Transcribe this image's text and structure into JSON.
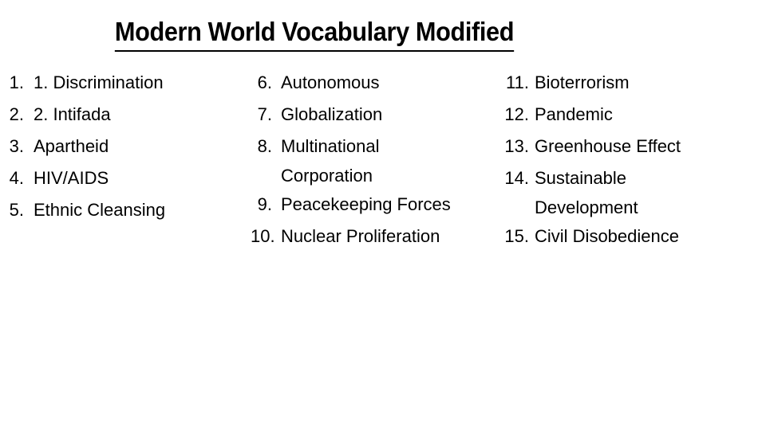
{
  "slide": {
    "title": "Modern World Vocabulary Modified",
    "background_color": "#ffffff",
    "text_color": "#000000"
  },
  "columns": [
    {
      "name": "column-one",
      "items": [
        {
          "number": "1.",
          "text": "1.  Discrimination",
          "lines": [
            "1.  Discrimination"
          ]
        },
        {
          "number": "2.",
          "text": "2.  Intifada",
          "lines": [
            "2.  Intifada"
          ]
        },
        {
          "number": "3.",
          "text": "Apartheid",
          "lines": [
            "Apartheid"
          ]
        },
        {
          "number": "4.",
          "text": "HIV/AIDS",
          "lines": [
            "HIV/AIDS"
          ]
        },
        {
          "number": "5.",
          "text": "Ethnic Cleansing",
          "lines": [
            "Ethnic Cleansing"
          ]
        }
      ]
    },
    {
      "name": "column-two",
      "items": [
        {
          "number": "6.",
          "text": "Autonomous",
          "lines": [
            "Autonomous"
          ]
        },
        {
          "number": "7.",
          "text": "Globalization",
          "lines": [
            "Globalization"
          ]
        },
        {
          "number": "8.",
          "text": "Multinational Corporation",
          "lines": [
            "Multinational",
            "Corporation"
          ]
        },
        {
          "number": "9.",
          "text": "Peacekeeping Forces",
          "lines": [
            "Peacekeeping Forces"
          ]
        },
        {
          "number": "10.",
          "text": "Nuclear Proliferation",
          "lines": [
            "Nuclear Proliferation"
          ]
        }
      ]
    },
    {
      "name": "column-three",
      "items": [
        {
          "number": "11.",
          "text": "Bioterrorism",
          "lines": [
            "Bioterrorism"
          ]
        },
        {
          "number": "12.",
          "text": "Pandemic",
          "lines": [
            "Pandemic"
          ]
        },
        {
          "number": "13.",
          "text": "Greenhouse Effect",
          "lines": [
            "Greenhouse Effect"
          ]
        },
        {
          "number": "14.",
          "text": "Sustainable Development",
          "lines": [
            "Sustainable",
            "Development"
          ]
        },
        {
          "number": "15.",
          "text": "Civil Disobedience",
          "lines": [
            "Civil Disobedience"
          ]
        }
      ]
    }
  ]
}
